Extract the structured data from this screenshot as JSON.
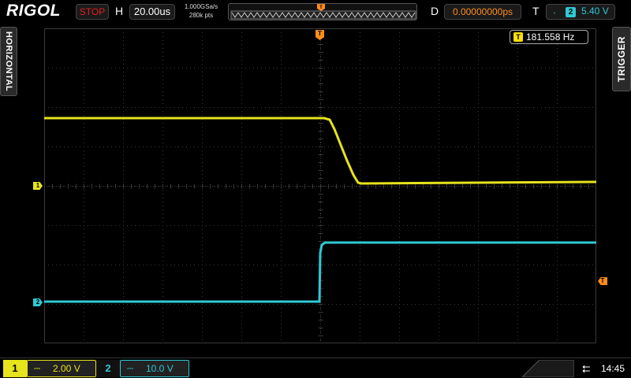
{
  "top_bar": {
    "brand": "RIGOL",
    "run_state": "STOP",
    "horizontal_label": "H",
    "timebase": "20.00us",
    "sample_rate": "1.000GSa/s",
    "memory_depth": "280k pts",
    "delay_label": "D",
    "delay": "0.00000000ps",
    "trigger_label": "T",
    "trigger_edge_icon": "rising-edge-icon",
    "trigger_source": "2",
    "trigger_level": "5.40 V"
  },
  "side_tabs": {
    "left": "HORIZONTAL",
    "right": "TRIGGER"
  },
  "measurement": {
    "icon": "T",
    "frequency": "181.558 Hz"
  },
  "markers": {
    "ch1": "1",
    "ch2": "2",
    "trigger_position": "T",
    "trigger_level": "T"
  },
  "channels": [
    {
      "number": "1",
      "coupling_icon": "dc-coupling-icon",
      "scale": "2.00 V",
      "color": "#e7e31d"
    },
    {
      "number": "2",
      "coupling_icon": "dc-coupling-icon",
      "scale": "10.0 V",
      "color": "#2fc9d4"
    }
  ],
  "status": {
    "usb_icon": "usb-icon",
    "time": "14:45"
  },
  "colors": {
    "ch1": "#e7e31d",
    "ch2": "#2fc9d4",
    "trigger": "#ff8c1a",
    "grid": "#3a3a3a"
  }
}
